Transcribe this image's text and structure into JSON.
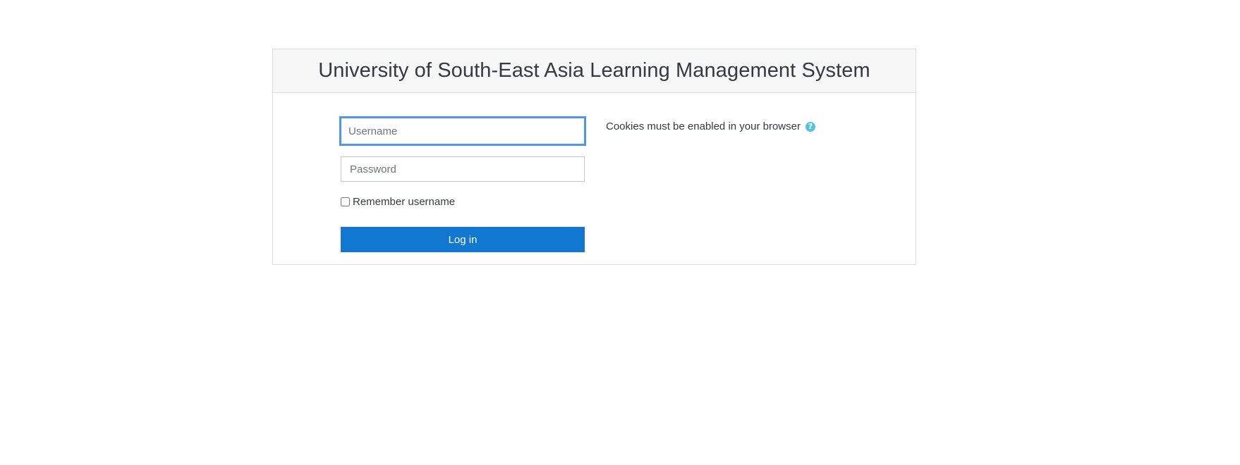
{
  "header": {
    "title": "University of South-East Asia Learning Management System"
  },
  "login_form": {
    "username": {
      "value": "",
      "placeholder": "Username"
    },
    "password": {
      "value": "",
      "placeholder": "Password"
    },
    "remember_label": "Remember username",
    "remember_checked": false,
    "submit_label": "Log in"
  },
  "cookies_notice": {
    "text": "Cookies must be enabled in your browser",
    "help_icon": "question-circle-icon",
    "help_glyph": "?"
  },
  "colors": {
    "button_bg": "#1177d1",
    "focus_border": "#4f96e6",
    "help_icon": "#5bc0de",
    "header_bg": "#f7f7f7"
  }
}
